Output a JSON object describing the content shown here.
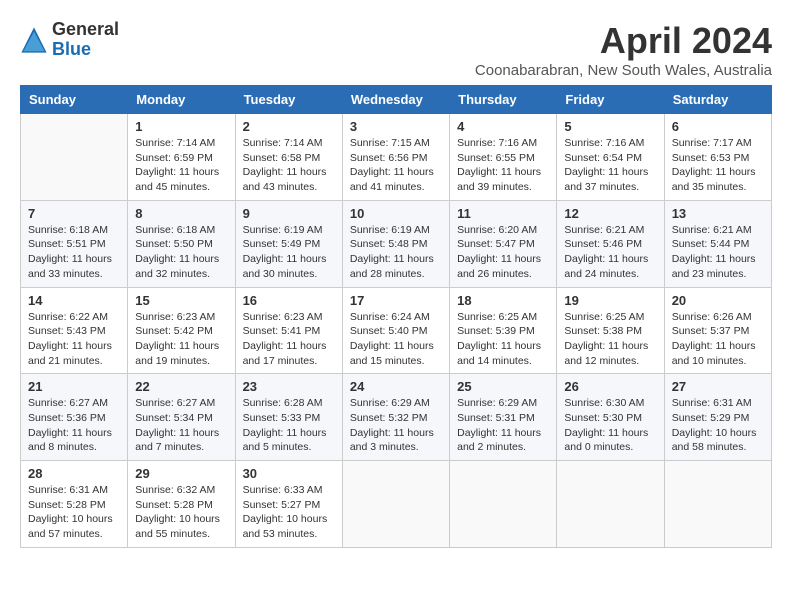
{
  "logo": {
    "general": "General",
    "blue": "Blue"
  },
  "title": "April 2024",
  "location": "Coonabarabran, New South Wales, Australia",
  "days_of_week": [
    "Sunday",
    "Monday",
    "Tuesday",
    "Wednesday",
    "Thursday",
    "Friday",
    "Saturday"
  ],
  "weeks": [
    [
      {
        "day": "",
        "info": ""
      },
      {
        "day": "1",
        "info": "Sunrise: 7:14 AM\nSunset: 6:59 PM\nDaylight: 11 hours\nand 45 minutes."
      },
      {
        "day": "2",
        "info": "Sunrise: 7:14 AM\nSunset: 6:58 PM\nDaylight: 11 hours\nand 43 minutes."
      },
      {
        "day": "3",
        "info": "Sunrise: 7:15 AM\nSunset: 6:56 PM\nDaylight: 11 hours\nand 41 minutes."
      },
      {
        "day": "4",
        "info": "Sunrise: 7:16 AM\nSunset: 6:55 PM\nDaylight: 11 hours\nand 39 minutes."
      },
      {
        "day": "5",
        "info": "Sunrise: 7:16 AM\nSunset: 6:54 PM\nDaylight: 11 hours\nand 37 minutes."
      },
      {
        "day": "6",
        "info": "Sunrise: 7:17 AM\nSunset: 6:53 PM\nDaylight: 11 hours\nand 35 minutes."
      }
    ],
    [
      {
        "day": "7",
        "info": "Sunrise: 6:18 AM\nSunset: 5:51 PM\nDaylight: 11 hours\nand 33 minutes."
      },
      {
        "day": "8",
        "info": "Sunrise: 6:18 AM\nSunset: 5:50 PM\nDaylight: 11 hours\nand 32 minutes."
      },
      {
        "day": "9",
        "info": "Sunrise: 6:19 AM\nSunset: 5:49 PM\nDaylight: 11 hours\nand 30 minutes."
      },
      {
        "day": "10",
        "info": "Sunrise: 6:19 AM\nSunset: 5:48 PM\nDaylight: 11 hours\nand 28 minutes."
      },
      {
        "day": "11",
        "info": "Sunrise: 6:20 AM\nSunset: 5:47 PM\nDaylight: 11 hours\nand 26 minutes."
      },
      {
        "day": "12",
        "info": "Sunrise: 6:21 AM\nSunset: 5:46 PM\nDaylight: 11 hours\nand 24 minutes."
      },
      {
        "day": "13",
        "info": "Sunrise: 6:21 AM\nSunset: 5:44 PM\nDaylight: 11 hours\nand 23 minutes."
      }
    ],
    [
      {
        "day": "14",
        "info": "Sunrise: 6:22 AM\nSunset: 5:43 PM\nDaylight: 11 hours\nand 21 minutes."
      },
      {
        "day": "15",
        "info": "Sunrise: 6:23 AM\nSunset: 5:42 PM\nDaylight: 11 hours\nand 19 minutes."
      },
      {
        "day": "16",
        "info": "Sunrise: 6:23 AM\nSunset: 5:41 PM\nDaylight: 11 hours\nand 17 minutes."
      },
      {
        "day": "17",
        "info": "Sunrise: 6:24 AM\nSunset: 5:40 PM\nDaylight: 11 hours\nand 15 minutes."
      },
      {
        "day": "18",
        "info": "Sunrise: 6:25 AM\nSunset: 5:39 PM\nDaylight: 11 hours\nand 14 minutes."
      },
      {
        "day": "19",
        "info": "Sunrise: 6:25 AM\nSunset: 5:38 PM\nDaylight: 11 hours\nand 12 minutes."
      },
      {
        "day": "20",
        "info": "Sunrise: 6:26 AM\nSunset: 5:37 PM\nDaylight: 11 hours\nand 10 minutes."
      }
    ],
    [
      {
        "day": "21",
        "info": "Sunrise: 6:27 AM\nSunset: 5:36 PM\nDaylight: 11 hours\nand 8 minutes."
      },
      {
        "day": "22",
        "info": "Sunrise: 6:27 AM\nSunset: 5:34 PM\nDaylight: 11 hours\nand 7 minutes."
      },
      {
        "day": "23",
        "info": "Sunrise: 6:28 AM\nSunset: 5:33 PM\nDaylight: 11 hours\nand 5 minutes."
      },
      {
        "day": "24",
        "info": "Sunrise: 6:29 AM\nSunset: 5:32 PM\nDaylight: 11 hours\nand 3 minutes."
      },
      {
        "day": "25",
        "info": "Sunrise: 6:29 AM\nSunset: 5:31 PM\nDaylight: 11 hours\nand 2 minutes."
      },
      {
        "day": "26",
        "info": "Sunrise: 6:30 AM\nSunset: 5:30 PM\nDaylight: 11 hours\nand 0 minutes."
      },
      {
        "day": "27",
        "info": "Sunrise: 6:31 AM\nSunset: 5:29 PM\nDaylight: 10 hours\nand 58 minutes."
      }
    ],
    [
      {
        "day": "28",
        "info": "Sunrise: 6:31 AM\nSunset: 5:28 PM\nDaylight: 10 hours\nand 57 minutes."
      },
      {
        "day": "29",
        "info": "Sunrise: 6:32 AM\nSunset: 5:28 PM\nDaylight: 10 hours\nand 55 minutes."
      },
      {
        "day": "30",
        "info": "Sunrise: 6:33 AM\nSunset: 5:27 PM\nDaylight: 10 hours\nand 53 minutes."
      },
      {
        "day": "",
        "info": ""
      },
      {
        "day": "",
        "info": ""
      },
      {
        "day": "",
        "info": ""
      },
      {
        "day": "",
        "info": ""
      }
    ]
  ]
}
